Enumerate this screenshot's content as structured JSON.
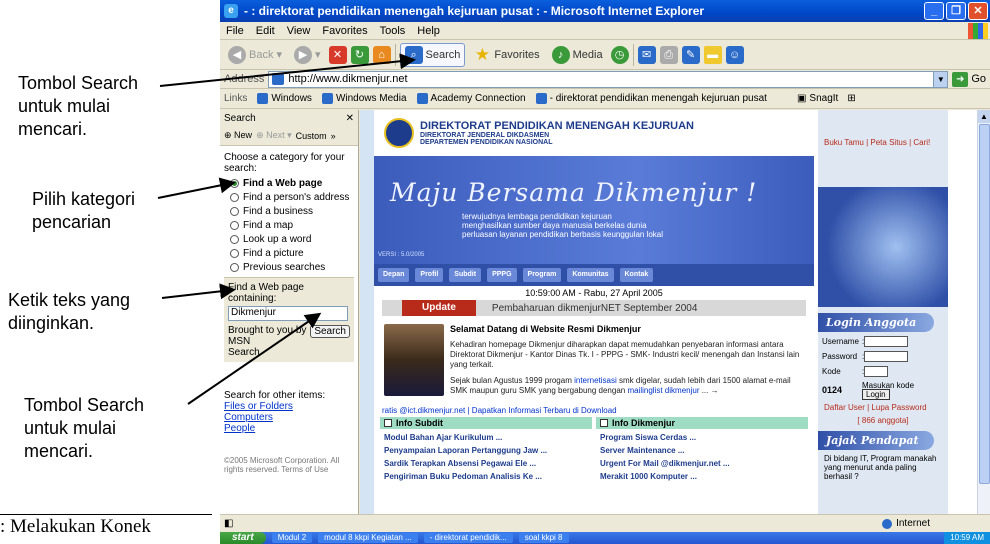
{
  "annotations": {
    "search_button_1": [
      "Tombol Search",
      "untuk mulai",
      "mencari."
    ],
    "category": [
      "Pilih kategori",
      "pencarian"
    ],
    "type_text": [
      "Ketik teks yang",
      "diinginkan."
    ],
    "search_button_2": [
      "Tombol Search",
      "untuk mulai",
      "mencari."
    ],
    "footer": ": Melakukan Konek"
  },
  "window": {
    "title": "- : direktorat pendidikan menengah kejuruan pusat : - Microsoft Internet Explorer",
    "menu": [
      "File",
      "Edit",
      "View",
      "Favorites",
      "Tools",
      "Help"
    ],
    "toolbar": {
      "back": "Back",
      "search": "Search",
      "favorites": "Favorites",
      "media": "Media"
    },
    "address_label": "Address",
    "url": "http://www.dikmenjur.net",
    "go": "Go",
    "links_label": "Links",
    "links": [
      "Windows",
      "Windows Media",
      "Academy Connection",
      "- direktorat pendidikan menengah kejuruan pusat"
    ],
    "snagit": "SnagIt"
  },
  "search_pane": {
    "title": "Search",
    "new": "New",
    "next": "Next",
    "custom": "Custom",
    "choose": "Choose a category for your search:",
    "options": [
      "Find a Web page",
      "Find a person's address",
      "Find a business",
      "Find a map",
      "Look up a word",
      "Find a picture",
      "Previous searches"
    ],
    "find_label": "Find a Web page containing:",
    "query": "Dikmenjur",
    "brought": "Brought to you by MSN",
    "search_label": "Search",
    "search_btn": "Search",
    "other_items": "Search for other items:",
    "other_links": [
      "Files or Folders",
      "Computers",
      "People"
    ],
    "copyright": "©2005 Microsoft Corporation. All rights reserved.",
    "terms": "Terms of Use"
  },
  "page": {
    "org_title": "DIREKTORAT PENDIDIKAN MENENGAH KEJURUAN",
    "org_sub1": "DIREKTORAT JENDERAL DIKDASMEN",
    "org_sub2": "DEPARTEMEN PENDIDIKAN NASIONAL",
    "motto": "Maju Bersama Dikmenjur !",
    "sub_lines": [
      "terwujudnya lembaga pendidikan kejuruan",
      "menghasilkan sumber daya manusia berkelas dunia",
      "perluasan layanan pendidikan berbasis keunggulan lokal"
    ],
    "version": "VERSI : 5.0/2005",
    "nav": [
      "Depan",
      "Profil",
      "Subdit",
      "PPPG",
      "Program",
      "Komunitas",
      "Kontak"
    ],
    "datetime": "10:59:00 AM - Rabu, 27 April 2005",
    "update_label": "Update",
    "update_text": "Pembaharuan dikmenjurNET September 2004",
    "welcome_title": "Selamat Datang di Website Resmi Dikmenjur",
    "welcome_p1": "Kehadiran homepage Dikmenjur diharapkan dapat memudahkan penyebaran informasi antara Direktorat Dikmenjur - Kantor Dinas Tk. I - PPPG - SMK- Industri kecil/ menengah dan Instansi lain yang terkait.",
    "welcome_p2_a": "Sejak bulan Agustus 1999 progam ",
    "welcome_p2_link1": "internetisasi",
    "welcome_p2_b": " smk digelar, sudah lebih dari 1500 alamat e-mail SMK maupun guru SMK yang bergabung dengan ",
    "welcome_p2_link2": "mailinglist dikmenjur",
    "welcome_p2_c": " ...  →",
    "ratis": "ratis @ict.dikmenjur.net | Dapatkan Informasi Terbaru di Download",
    "info_subdit_title": "Info Subdit",
    "info_subdit": [
      "Modul Bahan Ajar Kurikulum ...",
      "Penyampaian Laporan Pertanggung Jaw ...",
      "Sardik Terapkan Absensi Pegawai Ele ...",
      "Pengiriman Buku Pedoman Analisis Ke ..."
    ],
    "info_dik_title": "Info Dikmenjur",
    "info_dik": [
      "Program Siswa Cerdas ...",
      "Server Maintenance ...",
      "Urgent For Mail @dikmenjur.net ...",
      "Merakit 1000 Komputer ..."
    ],
    "right_links": "Buku Tamu | Peta Situs | Cari!",
    "login_title": "Login Anggota",
    "username": "Username",
    "password": "Password",
    "kode": "Kode",
    "code_value": "0124",
    "masukan": "Masukan kode",
    "login_btn": "Login",
    "daftar": "Daftar User | Lupa Password",
    "anggota": "[ 866 anggota]",
    "poll_title": "Jajak Pendapat",
    "poll_text": "Di bidang IT, Program manakah yang menurut anda paling berhasil ?"
  },
  "status": {
    "zone": "Internet"
  },
  "taskbar": {
    "start": "start",
    "tasks": [
      "Modul 2",
      "modul 8 kkpi Kegiatan ...",
      "- direktorat pendidik...",
      "soal kkpi 8"
    ],
    "clock": "10:59 AM"
  }
}
